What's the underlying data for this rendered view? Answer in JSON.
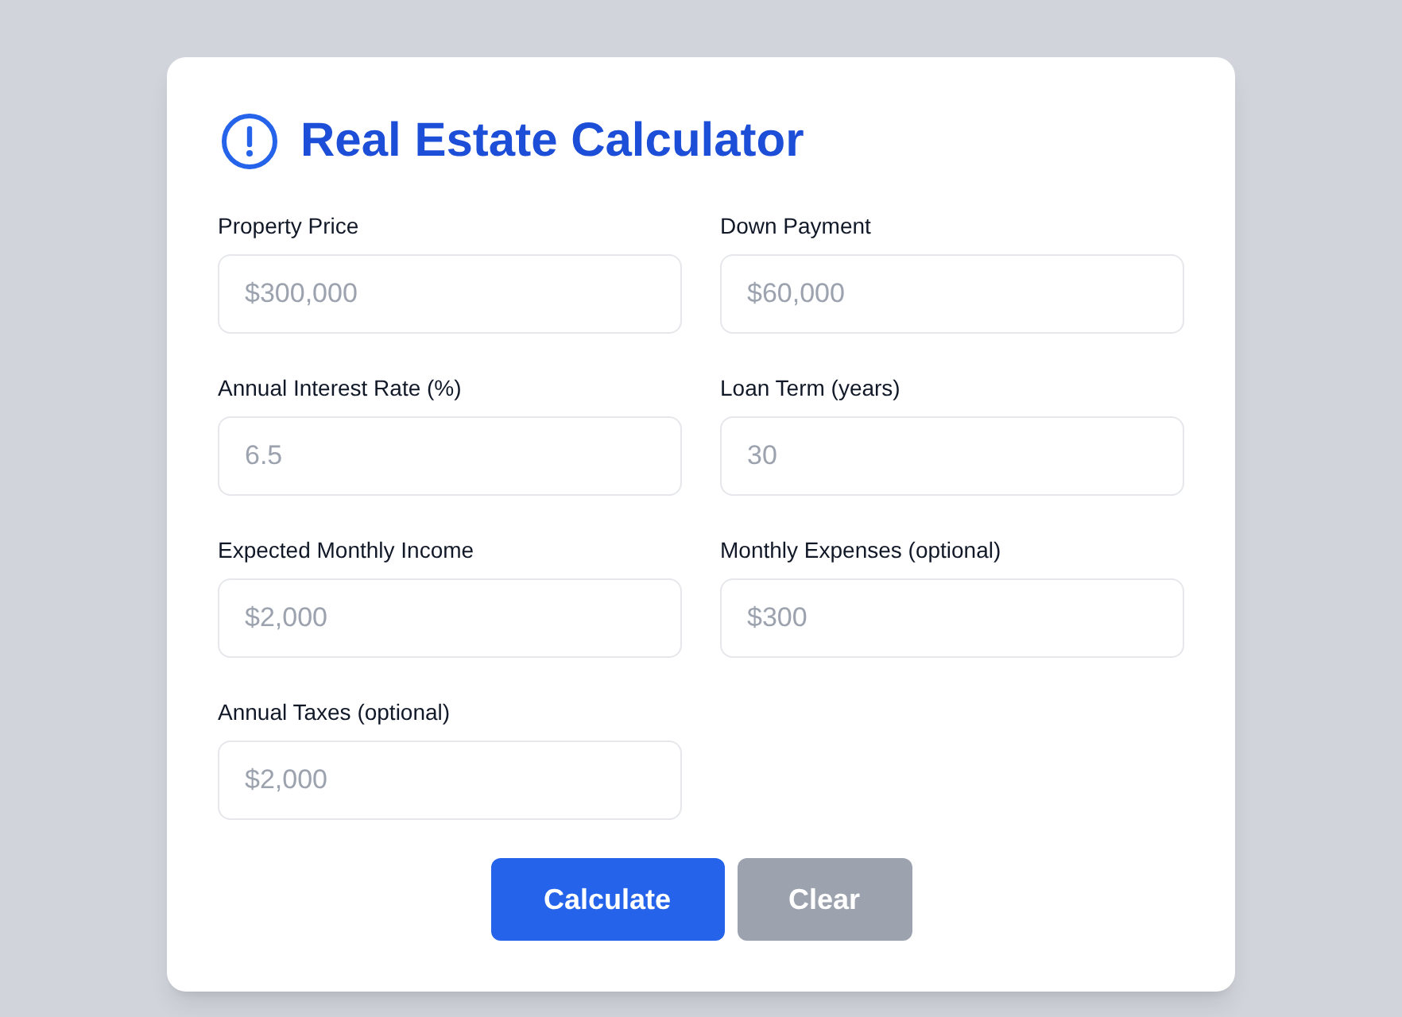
{
  "header": {
    "title": "Real Estate Calculator"
  },
  "fields": [
    {
      "label": "Property Price",
      "placeholder": "$300,000"
    },
    {
      "label": "Down Payment",
      "placeholder": "$60,000"
    },
    {
      "label": "Annual Interest Rate (%)",
      "placeholder": "6.5"
    },
    {
      "label": "Loan Term (years)",
      "placeholder": "30"
    },
    {
      "label": "Expected Monthly Income",
      "placeholder": "$2,000"
    },
    {
      "label": "Monthly Expenses (optional)",
      "placeholder": "$300"
    },
    {
      "label": "Annual Taxes (optional)",
      "placeholder": "$2,000"
    }
  ],
  "buttons": [
    {
      "label": "Calculate",
      "kind": "primary"
    },
    {
      "label": "Clear",
      "kind": "secondary"
    }
  ]
}
